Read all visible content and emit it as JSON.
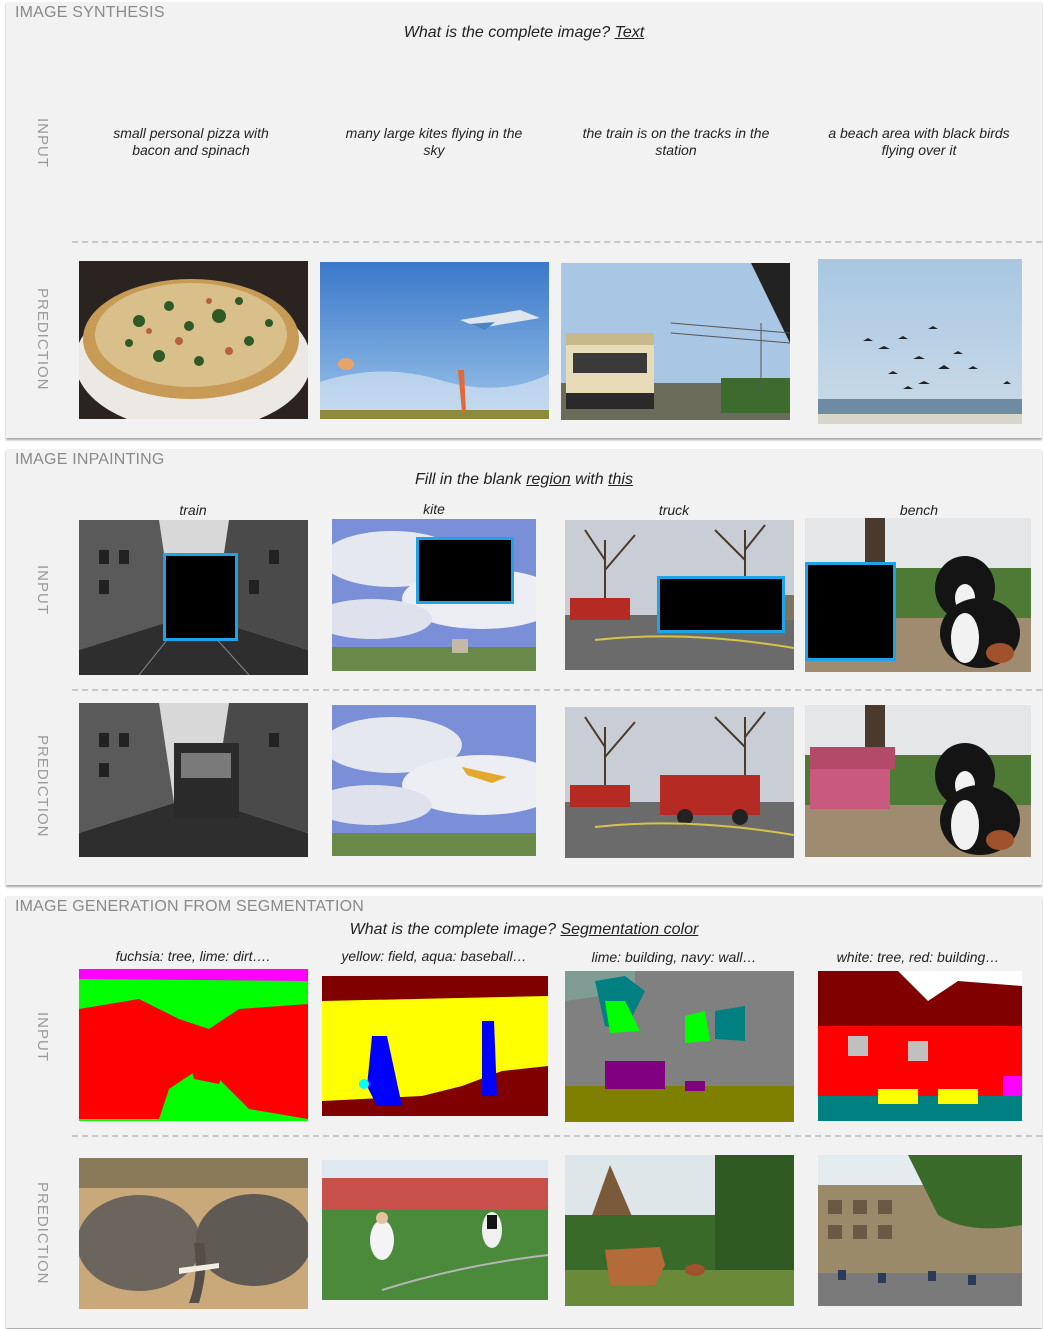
{
  "sections": [
    {
      "title": "IMAGE SYNTHESIS",
      "prompt_text": "What is the complete image?",
      "prompt_link": "Text",
      "input_label": "INPUT",
      "prediction_label": "PREDICTION",
      "captions": [
        "small personal pizza with bacon and spinach",
        "many large kites flying in the sky",
        "the train is on the tracks in the station",
        "a beach area with black birds flying over it"
      ],
      "predictions": [
        "pizza-photo",
        "kites-sky-photo",
        "train-station-photo",
        "beach-birds-photo"
      ]
    },
    {
      "title": "IMAGE INPAINTING",
      "prompt_text_1": "Fill in the blank",
      "prompt_link_1": "region",
      "prompt_text_2": "with",
      "prompt_link_2": "this",
      "input_label": "INPUT",
      "prediction_label": "PREDICTION",
      "labels": [
        "train",
        "kite",
        "truck",
        "bench"
      ],
      "inputs": [
        "street-masked-photo",
        "clouds-masked-photo",
        "firetrucks-masked-photo",
        "dog-masked-photo"
      ],
      "predictions": [
        "street-tram-photo",
        "clouds-kite-photo",
        "firetruck-photo",
        "dog-bench-photo"
      ],
      "mask_color": "#1ea3e6"
    },
    {
      "title": "IMAGE GENERATION FROM SEGMENTATION",
      "prompt_text": "What is the complete image?",
      "prompt_link": "Segmentation color",
      "input_label": "INPUT",
      "prediction_label": "PREDICTION",
      "labels": [
        "fuchsia: tree, lime: dirt….",
        "yellow: field, aqua: baseball…",
        "lime: building, navy: wall…",
        "white: tree, red: building…"
      ],
      "inputs": [
        "segmentation-map-elephants",
        "segmentation-map-baseball",
        "segmentation-map-cow",
        "segmentation-map-buildings"
      ],
      "predictions": [
        "elephants-photo",
        "baseball-field-photo",
        "cow-jungle-photo",
        "plaza-buildings-photo"
      ]
    }
  ]
}
